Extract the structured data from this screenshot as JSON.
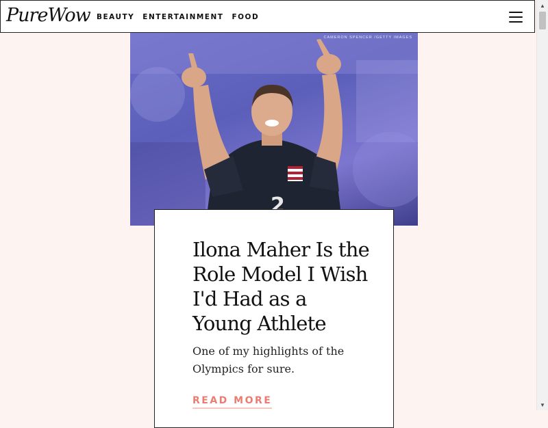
{
  "header": {
    "logo_text": "PureWow",
    "nav": [
      {
        "label": "BEAUTY"
      },
      {
        "label": "ENTERTAINMENT"
      },
      {
        "label": "FOOD"
      }
    ],
    "menu_icon": "hamburger-menu-icon"
  },
  "hero": {
    "photo_credit": "CAMERON SPENCER /GETTY IMAGES",
    "image_subject": "athlete-pointing-upward-photo"
  },
  "article": {
    "headline": "Ilona Maher Is the Role Model I Wish I'd Had as a Young Athlete",
    "dek": "One of my highlights of the Olympics for sure.",
    "read_more_label": "READ MORE"
  },
  "colors": {
    "page_background": "#fdf3f1",
    "accent": "#ea7d72"
  }
}
